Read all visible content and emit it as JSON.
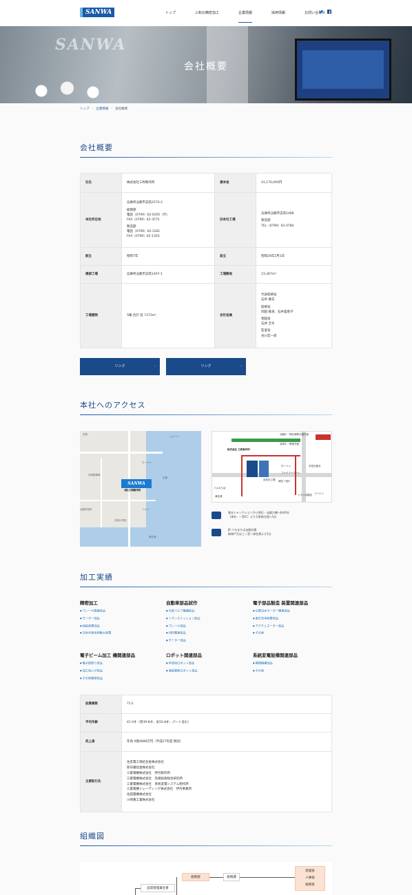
{
  "header": {
    "logo": "SANWA",
    "nav": [
      "トップ",
      "三和の精密加工",
      "企業情報",
      "採用情報",
      "お問い合わせ"
    ],
    "nav_active": 2,
    "social": [
      "twitter-icon",
      "facebook-icon"
    ]
  },
  "hero": {
    "title": "会社概要",
    "sign": "SANWA"
  },
  "breadcrumb": [
    "トップ",
    "企業情報",
    "会社概要"
  ],
  "overview": {
    "title": "会社概要",
    "rows": [
      {
        "l1": "社名",
        "v1": [
          "株式会社三和製作所"
        ],
        "l2": "資本金",
        "v2": [
          "41,170,000円"
        ]
      },
      {
        "l1": "本社所在地",
        "v1": [
          "兵庫県淡路市志筑2570-2",
          "",
          "総務部",
          "電話（0799）62-0265（代）",
          "FAX（0799）62-3575",
          "",
          "製造部",
          "電話（0799）62-1281",
          "FAX（0799）62-1303"
        ],
        "l2": "旧本社工場",
        "v2": [
          "兵庫県淡路市志筑1488",
          "",
          "製造部",
          "TEL（0799）62-0780"
        ]
      },
      {
        "l1": "創立",
        "v1": [
          "昭和7年"
        ],
        "l2": "設立",
        "v2": [
          "昭和26年2月1日"
        ]
      },
      {
        "l1": "掃部工場",
        "v1": [
          "兵庫県淡路市志筑1497-1"
        ],
        "l2": "工場敷地",
        "v2": [
          "23,367m²"
        ]
      },
      {
        "l1": "工場建物",
        "v1": [
          "5棟 合計 延 7373m²"
        ],
        "l2": "会社役員",
        "v2": [
          "代表取締役",
          "石井 康夫",
          "",
          "取締役",
          "岡田 継承、石井喜恵子",
          "",
          "相談役",
          "石井 吉幸",
          "",
          "監査役",
          "谷川宏一郎"
        ]
      }
    ],
    "links": [
      "リンク",
      "リンク"
    ]
  },
  "access": {
    "title": "本社へのアクセス",
    "map_marker": "SANWA",
    "map_sub": "(株)三和製作所",
    "map_labels": [
      "志筑",
      "ジョーン",
      "ローソン",
      "志筑郵便局",
      "淡路市役所",
      "生穂",
      "イオン",
      "津名港",
      "志筑小学校"
    ],
    "route_labels": [
      "株式会社 三和製作所",
      "旧本社工場",
      "津名一宮IC",
      "ローソン",
      "ファミリーマート",
      "イオン淡路店",
      "コーナン",
      "津名港",
      "淡路IC・明石海峡大橋方面",
      "洲本IC・徳島方面",
      "バスのりば",
      "中田交差点"
    ],
    "transport": [
      {
        "icon": "car-icon",
        "lines": [
          "垂水ジャンクションから明石・淡路大橋へ約40分",
          "（津名・一宮IC）より大阪南方面へ5分"
        ]
      },
      {
        "icon": "train-icon",
        "lines": [
          "JR バスまたは淡路交通",
          "新神戸又は三ノ宮～津名港より5分"
        ]
      }
    ]
  },
  "works": {
    "title": "加工実績",
    "categories": [
      {
        "name": "精密加工",
        "items": [
          "ブレーキ関連部品",
          "モーター部品",
          "船舶装置部品",
          "次世代車両用動力装置"
        ]
      },
      {
        "name": "自動車部品試作",
        "items": [
          "可変バルブ機構部品",
          "トランスミッション部品",
          "ブレーキ部品",
          "ABS関連部品",
          "モーター部品"
        ]
      },
      {
        "name": "電子部品製造 装置関連部品",
        "items": [
          "位置決めモーター関連部品",
          "真空洗浄装置部品",
          "アクチュエーター部品",
          "その他"
        ]
      },
      {
        "name": "電子ビーム加工 機関連部品",
        "items": [
          "電子銃周り部品",
          "加工用ジグ部品",
          "その他精密部品"
        ]
      },
      {
        "name": "ロボット関連部品",
        "items": [
          "半導体ロボット部品",
          "溶接業務ロボット部品"
        ]
      },
      {
        "name": "系統変電設備関連部品",
        "items": [
          "開閉機構部品",
          "その他"
        ]
      }
    ]
  },
  "stats": {
    "rows": [
      {
        "label": "従業員数",
        "value": [
          "71人"
        ]
      },
      {
        "label": "平均年齢",
        "value": [
          "41.0才（男39.8才、女50.8才、パート含む）"
        ]
      },
      {
        "label": "売上高",
        "value": [
          "年商 9億4888万円（平成27年度 税別）"
        ]
      },
      {
        "label": "主要取引先",
        "value": [
          "住友電工焼結合金株式会社",
          "新日鐵住金株式会社",
          "三菱電機株式会社　伊丹製作所",
          "三菱電機株式会社　先端技術総合研究所",
          "三菱電機株式会社　系統変電システム製作所",
          "三菱電機トレーディング株式会社　伊丹事業所",
          "住田電機株式会社",
          "川崎重工業株式会社"
        ]
      }
    ]
  },
  "org": {
    "title": "組織図",
    "boxes": [
      "総務部",
      "総務課",
      "総務係",
      "人事係",
      "経理係",
      "品質管理責任者"
    ]
  }
}
